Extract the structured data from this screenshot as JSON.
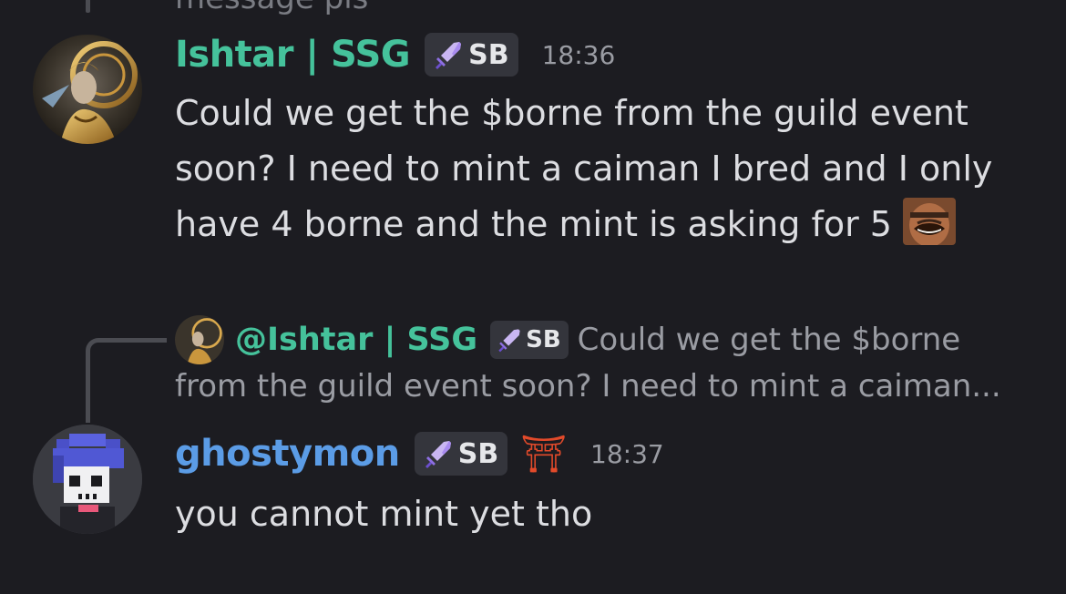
{
  "previous_message": {
    "cut_text": "message pls"
  },
  "messages": [
    {
      "username": "Ishtar | SSG",
      "username_color": "#45c29b",
      "role_tag": "SB",
      "role_icon": "sword-icon",
      "timestamp": "18:36",
      "lines": [
        "Could we get the $borne from the guild event",
        "soon? I need to mint a caiman I bred and I only",
        "have 4 borne and the mint is asking for 5"
      ],
      "inline_emoji": "laughing-man-emoji"
    },
    {
      "reply_to": {
        "username": "@Ishtar | SSG",
        "role_tag": "SB",
        "preview_line1": "Could we get the $borne",
        "preview_line2": "from the guild event soon? I need to mint a caiman..."
      },
      "username": "ghostymon",
      "username_color": "#5b9ce6",
      "role_tag": "SB",
      "role_icon": "sword-icon",
      "extra_icon": "torii-gate-icon",
      "extra_icon_glyph": "⛩",
      "timestamp": "18:37",
      "lines": [
        "you cannot mint yet tho"
      ]
    }
  ]
}
